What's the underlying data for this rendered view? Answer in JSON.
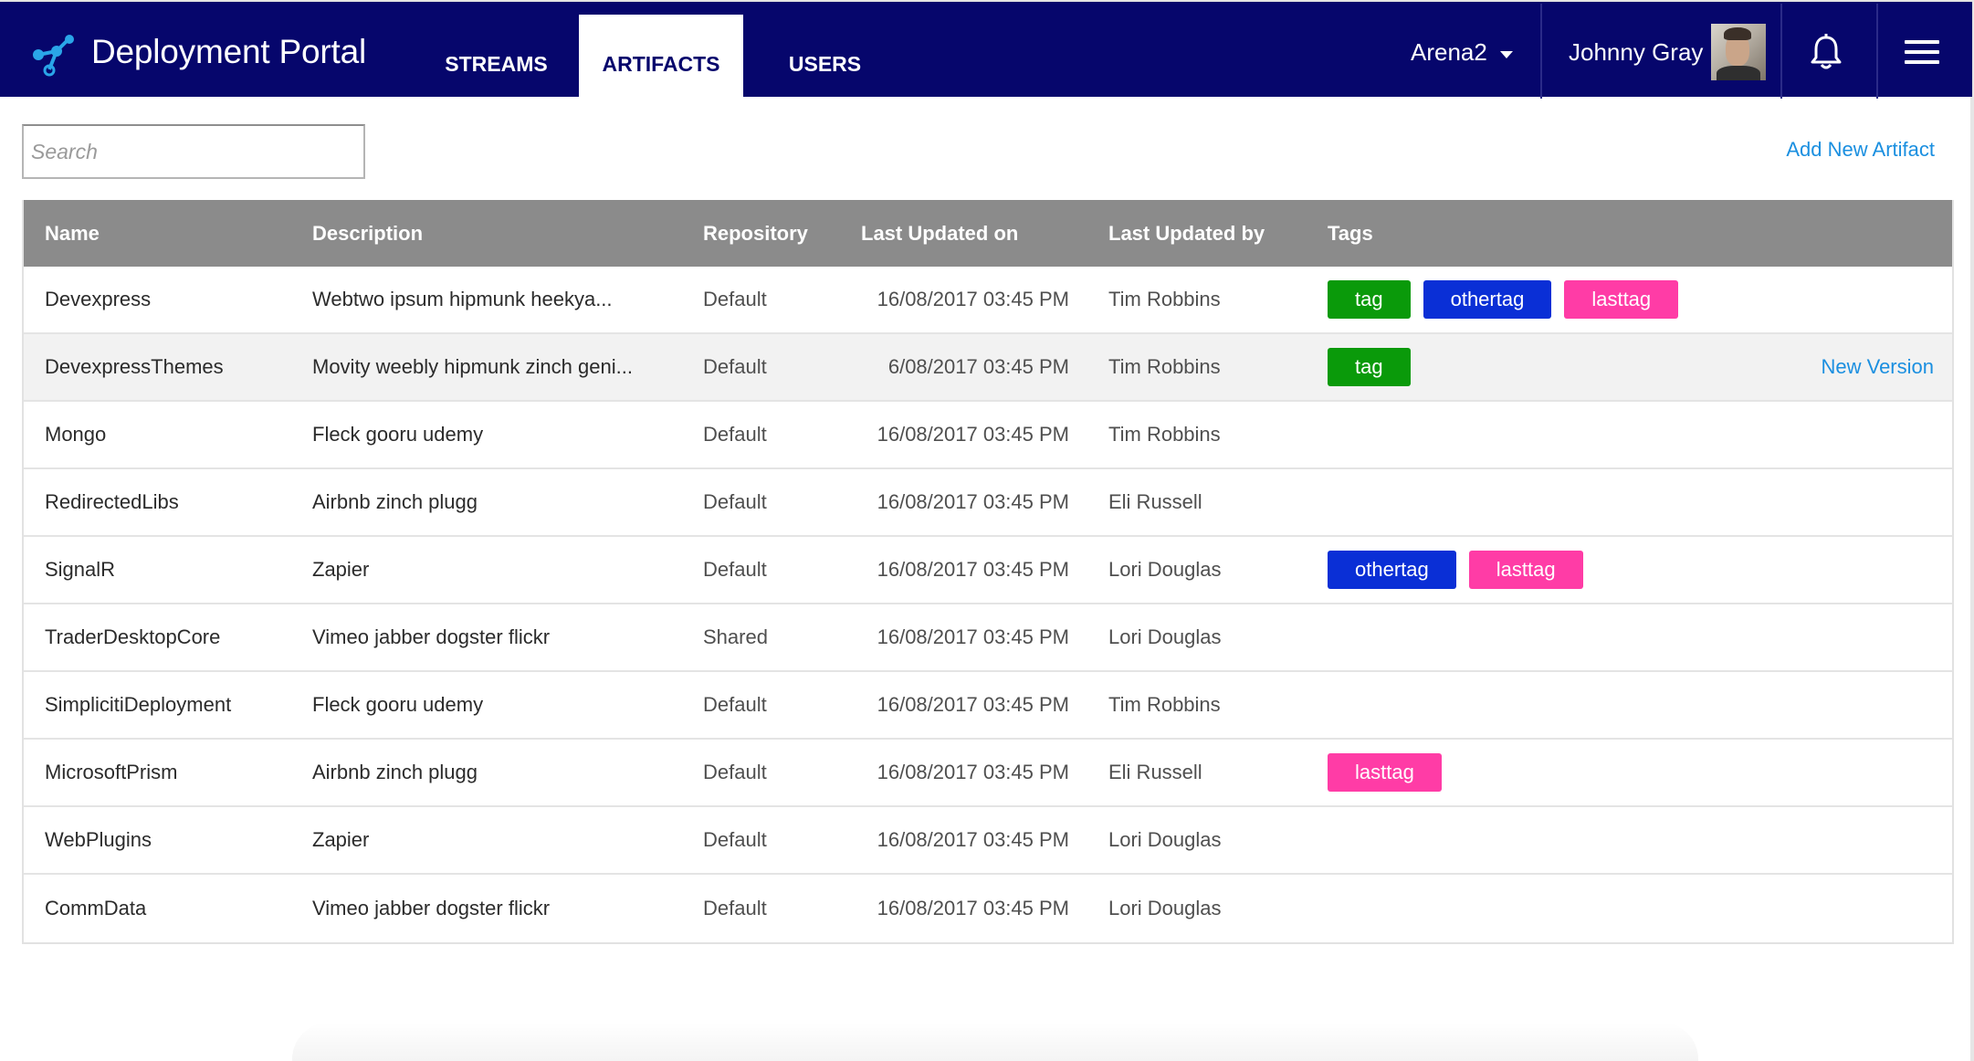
{
  "app": {
    "title": "Deployment Portal",
    "brand_color": "#06066c",
    "accent_color": "#1a8fe0"
  },
  "nav": {
    "tabs": [
      {
        "label": "STREAMS",
        "active": false
      },
      {
        "label": "ARTIFACTS",
        "active": true
      },
      {
        "label": "USERS",
        "active": false
      }
    ]
  },
  "header": {
    "environment": "Arena2",
    "user_name": "Johnny Gray",
    "icons": [
      "logo-icon",
      "chevron-down-icon",
      "avatar",
      "bell-icon",
      "hamburger-menu-icon"
    ]
  },
  "toolbar": {
    "search_placeholder": "Search",
    "search_value": "",
    "add_new_label": "Add New Artifact"
  },
  "table": {
    "columns": [
      "Name",
      "Description",
      "Repository",
      "Last Updated on",
      "Last Updated by",
      "Tags"
    ],
    "tag_colors": {
      "tag": "#0a9a0a",
      "othertag": "#0a2fd6",
      "lasttag": "#ff3ca6"
    },
    "rows": [
      {
        "name": "Devexpress",
        "description": "Webtwo ipsum hipmunk heekya...",
        "repository": "Default",
        "updated_on": "16/08/2017 03:45 PM",
        "updated_by": "Tim Robbins",
        "tags": [
          "tag",
          "othertag",
          "lasttag"
        ],
        "action": ""
      },
      {
        "name": "DevexpressThemes",
        "description": "Movity weebly hipmunk zinch geni...",
        "repository": "Default",
        "updated_on": "6/08/2017 03:45 PM",
        "updated_by": "Tim Robbins",
        "tags": [
          "tag"
        ],
        "action": "New Version",
        "highlighted": true
      },
      {
        "name": "Mongo",
        "description": "Fleck gooru udemy",
        "repository": "Default",
        "updated_on": "16/08/2017 03:45 PM",
        "updated_by": "Tim Robbins",
        "tags": [],
        "action": ""
      },
      {
        "name": "RedirectedLibs",
        "description": "Airbnb zinch plugg",
        "repository": "Default",
        "updated_on": "16/08/2017 03:45 PM",
        "updated_by": "Eli Russell",
        "tags": [],
        "action": ""
      },
      {
        "name": "SignalR",
        "description": "Zapier",
        "repository": "Default",
        "updated_on": "16/08/2017 03:45 PM",
        "updated_by": "Lori Douglas",
        "tags": [
          "othertag",
          "lasttag"
        ],
        "action": ""
      },
      {
        "name": "TraderDesktopCore",
        "description": "Vimeo jabber dogster flickr",
        "repository": "Shared",
        "updated_on": "16/08/2017 03:45 PM",
        "updated_by": "Lori Douglas",
        "tags": [],
        "action": ""
      },
      {
        "name": "SimplicitiDeployment",
        "description": "Fleck gooru udemy",
        "repository": "Default",
        "updated_on": "16/08/2017 03:45 PM",
        "updated_by": "Tim Robbins",
        "tags": [],
        "action": ""
      },
      {
        "name": "MicrosoftPrism",
        "description": "Airbnb zinch plugg",
        "repository": "Default",
        "updated_on": "16/08/2017 03:45 PM",
        "updated_by": "Eli Russell",
        "tags": [
          "lasttag"
        ],
        "action": ""
      },
      {
        "name": "WebPlugins",
        "description": "Zapier",
        "repository": "Default",
        "updated_on": "16/08/2017 03:45 PM",
        "updated_by": "Lori Douglas",
        "tags": [],
        "action": ""
      },
      {
        "name": "CommData",
        "description": "Vimeo jabber dogster flickr",
        "repository": "Default",
        "updated_on": "16/08/2017 03:45 PM",
        "updated_by": "Lori Douglas",
        "tags": [],
        "action": ""
      }
    ]
  }
}
